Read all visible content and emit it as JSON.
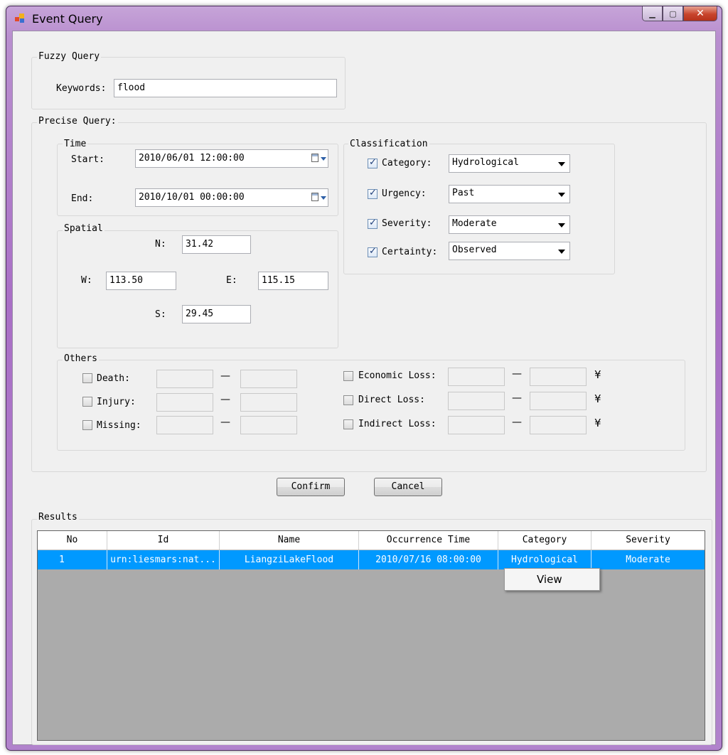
{
  "window": {
    "title": "Event Query",
    "buttons": {
      "minimize": "▁",
      "maximize": "▢",
      "close": "✕"
    }
  },
  "fuzzy_query": {
    "group_label": "Fuzzy Query",
    "keywords_label": "Keywords:",
    "keywords_value": "flood"
  },
  "precise_query": {
    "group_label": "Precise Query:",
    "time": {
      "group_label": "Time",
      "start_label": "Start:",
      "start_value": "2010/06/01 12:00:00",
      "end_label": "End:",
      "end_value": "2010/10/01 00:00:00"
    },
    "spatial": {
      "group_label": "Spatial",
      "n_label": "N:",
      "n_value": "31.42",
      "w_label": "W:",
      "w_value": "113.50",
      "e_label": "E:",
      "e_value": "115.15",
      "s_label": "S:",
      "s_value": "29.45"
    },
    "classification": {
      "group_label": "Classification",
      "items": [
        {
          "label": "Category:",
          "value": "Hydrological",
          "checked": true
        },
        {
          "label": "Urgency:",
          "value": "Past",
          "checked": true
        },
        {
          "label": "Severity:",
          "value": "Moderate",
          "checked": true
        },
        {
          "label": "Certainty:",
          "value": "Observed",
          "checked": true
        }
      ]
    },
    "others": {
      "group_label": "Others",
      "items": [
        {
          "label": "Death:",
          "checked": false
        },
        {
          "label": "Injury:",
          "checked": false
        },
        {
          "label": "Missing:",
          "checked": false
        },
        {
          "label": "Economic Loss:",
          "checked": false,
          "unit": "¥"
        },
        {
          "label": "Direct Loss:",
          "checked": false,
          "unit": "¥"
        },
        {
          "label": "Indirect Loss:",
          "checked": false,
          "unit": "¥"
        }
      ],
      "range_separator": "—"
    }
  },
  "actions": {
    "confirm_label": "Confirm",
    "cancel_label": "Cancel"
  },
  "results": {
    "group_label": "Results",
    "columns": [
      "No",
      "Id",
      "Name",
      "Occurrence Time",
      "Category",
      "Severity"
    ],
    "rows": [
      [
        "1",
        "urn:liesmars:nat...",
        "LiangziLakeFlood",
        "2010/07/16 08:00:00",
        "Hydrological",
        "Moderate"
      ]
    ],
    "selected_row_color": "#0099ff"
  },
  "context_menu": {
    "items": [
      "View"
    ]
  }
}
